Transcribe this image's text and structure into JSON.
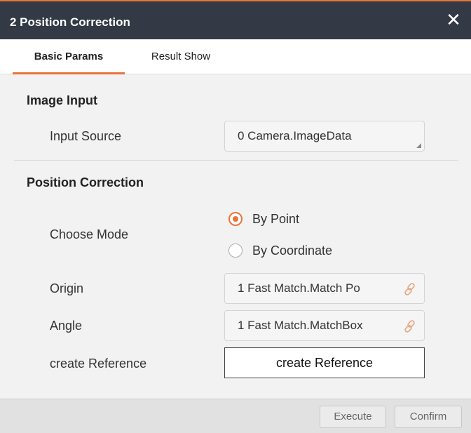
{
  "window": {
    "title": "2 Position Correction",
    "close_symbol": "✕",
    "accent": "#e8743b",
    "titlebar_color": "#333a45"
  },
  "tabs": [
    {
      "label": "Basic Params",
      "active": true
    },
    {
      "label": "Result Show",
      "active": false
    }
  ],
  "image_input": {
    "section_title": "Image Input",
    "input_source_label": "Input Source",
    "input_source_value": "0 Camera.ImageData"
  },
  "position_correction": {
    "section_title": "Position Correction",
    "choose_mode_label": "Choose Mode",
    "mode_options": [
      {
        "label": "By Point",
        "selected": true
      },
      {
        "label": "By Coordinate",
        "selected": false
      }
    ],
    "origin_label": "Origin",
    "origin_value": "1 Fast Match.Match Po",
    "angle_label": "Angle",
    "angle_value": "1 Fast Match.MatchBox",
    "create_reference_label": "create Reference",
    "create_reference_button": "create Reference",
    "link_icon": "link-icon"
  },
  "footer": {
    "execute_label": "Execute",
    "confirm_label": "Confirm"
  }
}
